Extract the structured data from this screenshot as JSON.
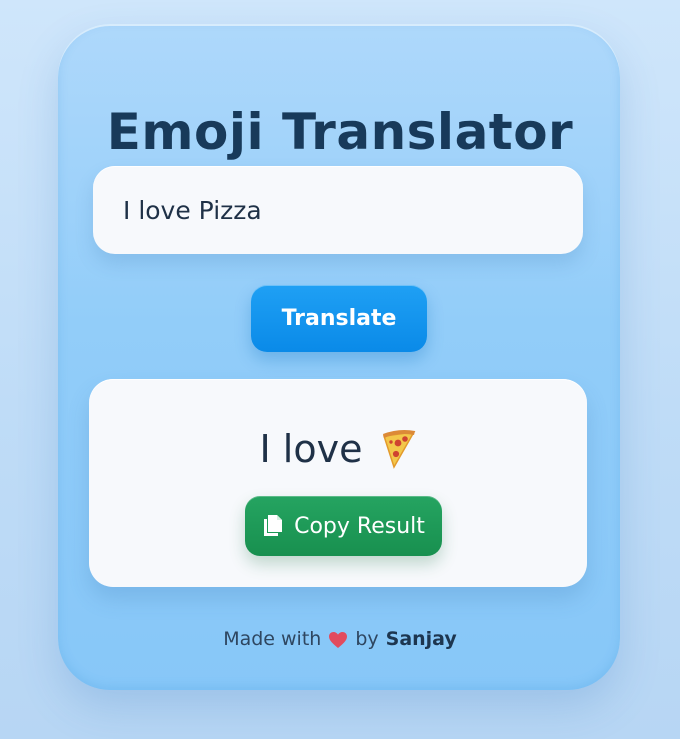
{
  "app": {
    "title": "Emoji Translator"
  },
  "input": {
    "value": "I love Pizza",
    "placeholder": ""
  },
  "buttons": {
    "translate_label": "Translate",
    "copy_label": "Copy Result"
  },
  "result": {
    "text": "I love",
    "emoji_icon": "pizza-icon"
  },
  "footer": {
    "made_with": "Made with",
    "by": "by",
    "author": "Sanjay",
    "heart_icon": "heart-icon"
  },
  "colors": {
    "page_background": "#c7e1f9",
    "card_background": "#92cdf9",
    "title_color": "#183a5a",
    "translate_button": "#0a8ae8",
    "copy_button": "#18904f",
    "surface": "#f7f9fc",
    "heart": "#e24b5e"
  }
}
